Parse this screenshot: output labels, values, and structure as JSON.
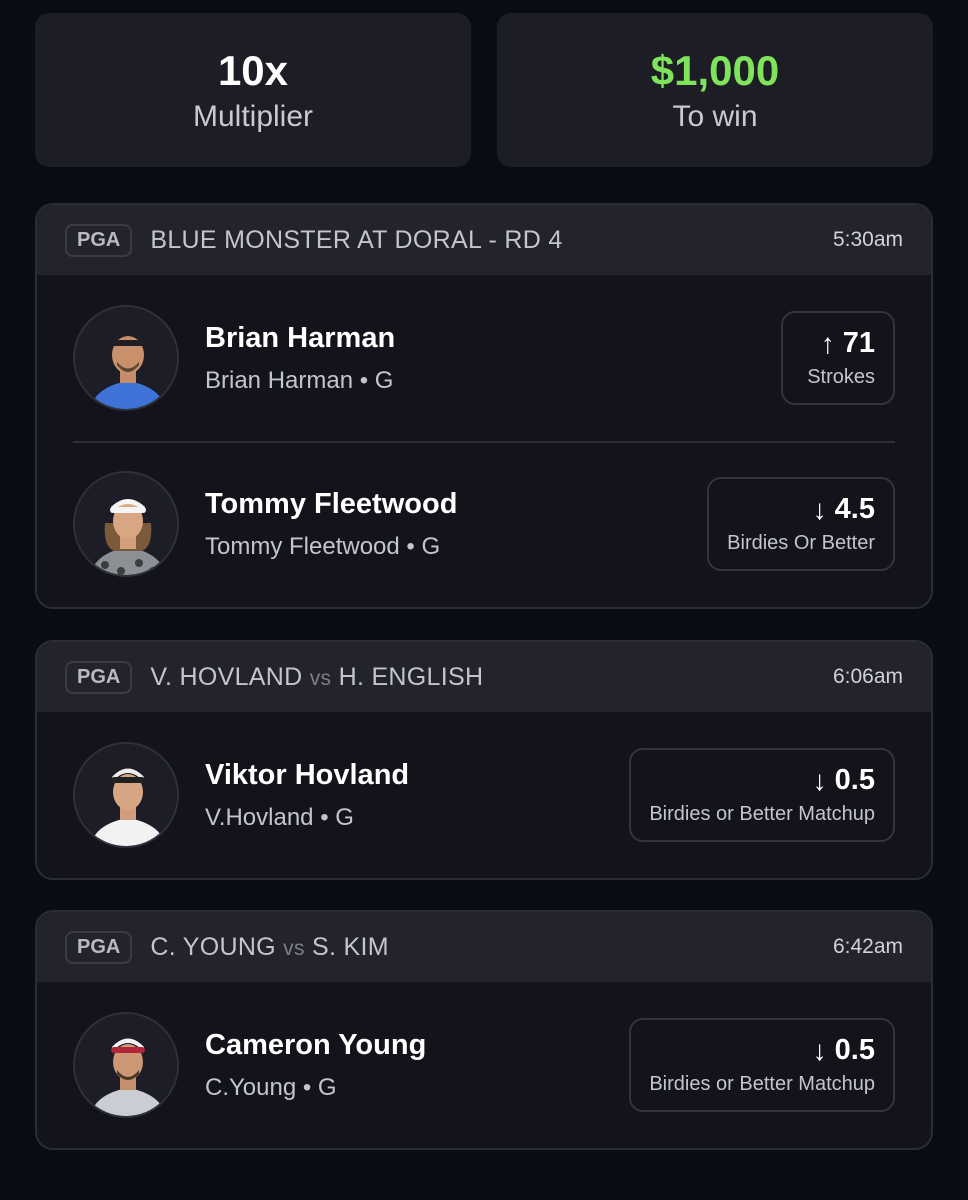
{
  "summary": {
    "multiplier_value": "10x",
    "multiplier_label": "Multiplier",
    "payout_value": "$1,000",
    "payout_label": "To win"
  },
  "cards": [
    {
      "league": "PGA",
      "event": "BLUE MONSTER AT DORAL - RD 4",
      "time": "5:30am",
      "picks": [
        {
          "name": "Brian Harman",
          "sub": "Brian Harman • G",
          "direction_icon": "arrow-up-icon",
          "arrow": "↑",
          "value": "71",
          "stat": "Strokes"
        },
        {
          "name": "Tommy Fleetwood",
          "sub": "Tommy Fleetwood • G",
          "direction_icon": "arrow-down-icon",
          "arrow": "↓",
          "value": "4.5",
          "stat": "Birdies Or Better"
        }
      ]
    },
    {
      "league": "PGA",
      "event_a": "V. HOVLAND",
      "event_vs": "vs",
      "event_b": "H. ENGLISH",
      "time": "6:06am",
      "picks": [
        {
          "name": "Viktor Hovland",
          "sub": "V.Hovland • G",
          "direction_icon": "arrow-down-icon",
          "arrow": "↓",
          "value": "0.5",
          "stat": "Birdies or Better Matchup"
        }
      ]
    },
    {
      "league": "PGA",
      "event_a": "C. YOUNG",
      "event_vs": "vs",
      "event_b": "S. KIM",
      "time": "6:42am",
      "picks": [
        {
          "name": "Cameron Young",
          "sub": "C.Young • G",
          "direction_icon": "arrow-down-icon",
          "arrow": "↓",
          "value": "0.5",
          "stat": "Birdies or Better Matchup"
        }
      ]
    }
  ],
  "colors": {
    "background": "#0a0c14",
    "card": "#12131b",
    "card_header": "#22232c",
    "payout_green": "#7fe35c"
  }
}
